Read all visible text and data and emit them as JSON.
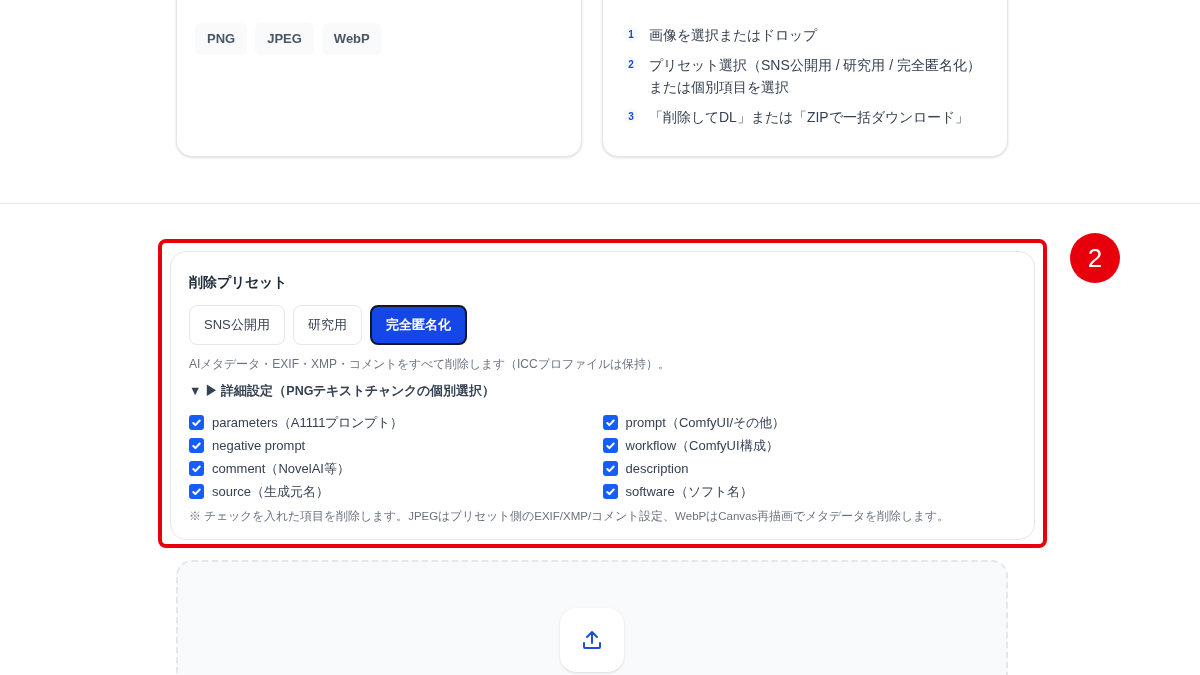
{
  "formats_card": {
    "chips": [
      "PNG",
      "JPEG",
      "WebP"
    ]
  },
  "usage_card": {
    "steps": [
      {
        "number": "1",
        "text": "画像を選択またはドロップ"
      },
      {
        "number": "2",
        "text": "プリセット選択（SNS公開用 / 研究用 / 完全匿名化）または個別項目を選択"
      },
      {
        "number": "3",
        "text": "「削除してDL」または「ZIPで一括ダウンロード」"
      }
    ]
  },
  "annotation": {
    "number": "2"
  },
  "preset_card": {
    "title": "削除プリセット",
    "presets": [
      {
        "label": "SNS公開用",
        "selected": false
      },
      {
        "label": "研究用",
        "selected": false
      },
      {
        "label": "完全匿名化",
        "selected": true
      }
    ],
    "description": "AIメタデータ・EXIF・XMP・コメントをすべて削除します（ICCプロファイルは保持）。",
    "details": {
      "label": "▼ ▶ 詳細設定（PNGテキストチャンクの個別選択）"
    },
    "chunks": [
      {
        "label": "parameters（A1111プロンプト）",
        "checked": true
      },
      {
        "label": "prompt（ComfyUI/その他）",
        "checked": true
      },
      {
        "label": "negative prompt",
        "checked": true
      },
      {
        "label": "workflow（ComfyUI構成）",
        "checked": true
      },
      {
        "label": "comment（NovelAI等）",
        "checked": true
      },
      {
        "label": "description",
        "checked": true
      },
      {
        "label": "source（生成元名）",
        "checked": true
      },
      {
        "label": "software（ソフト名）",
        "checked": true
      }
    ],
    "note": "※ チェックを入れた項目を削除します。JPEGはプリセット側のEXIF/XMP/コメント設定、WebPはCanvas再描画でメタデータを削除します。"
  }
}
